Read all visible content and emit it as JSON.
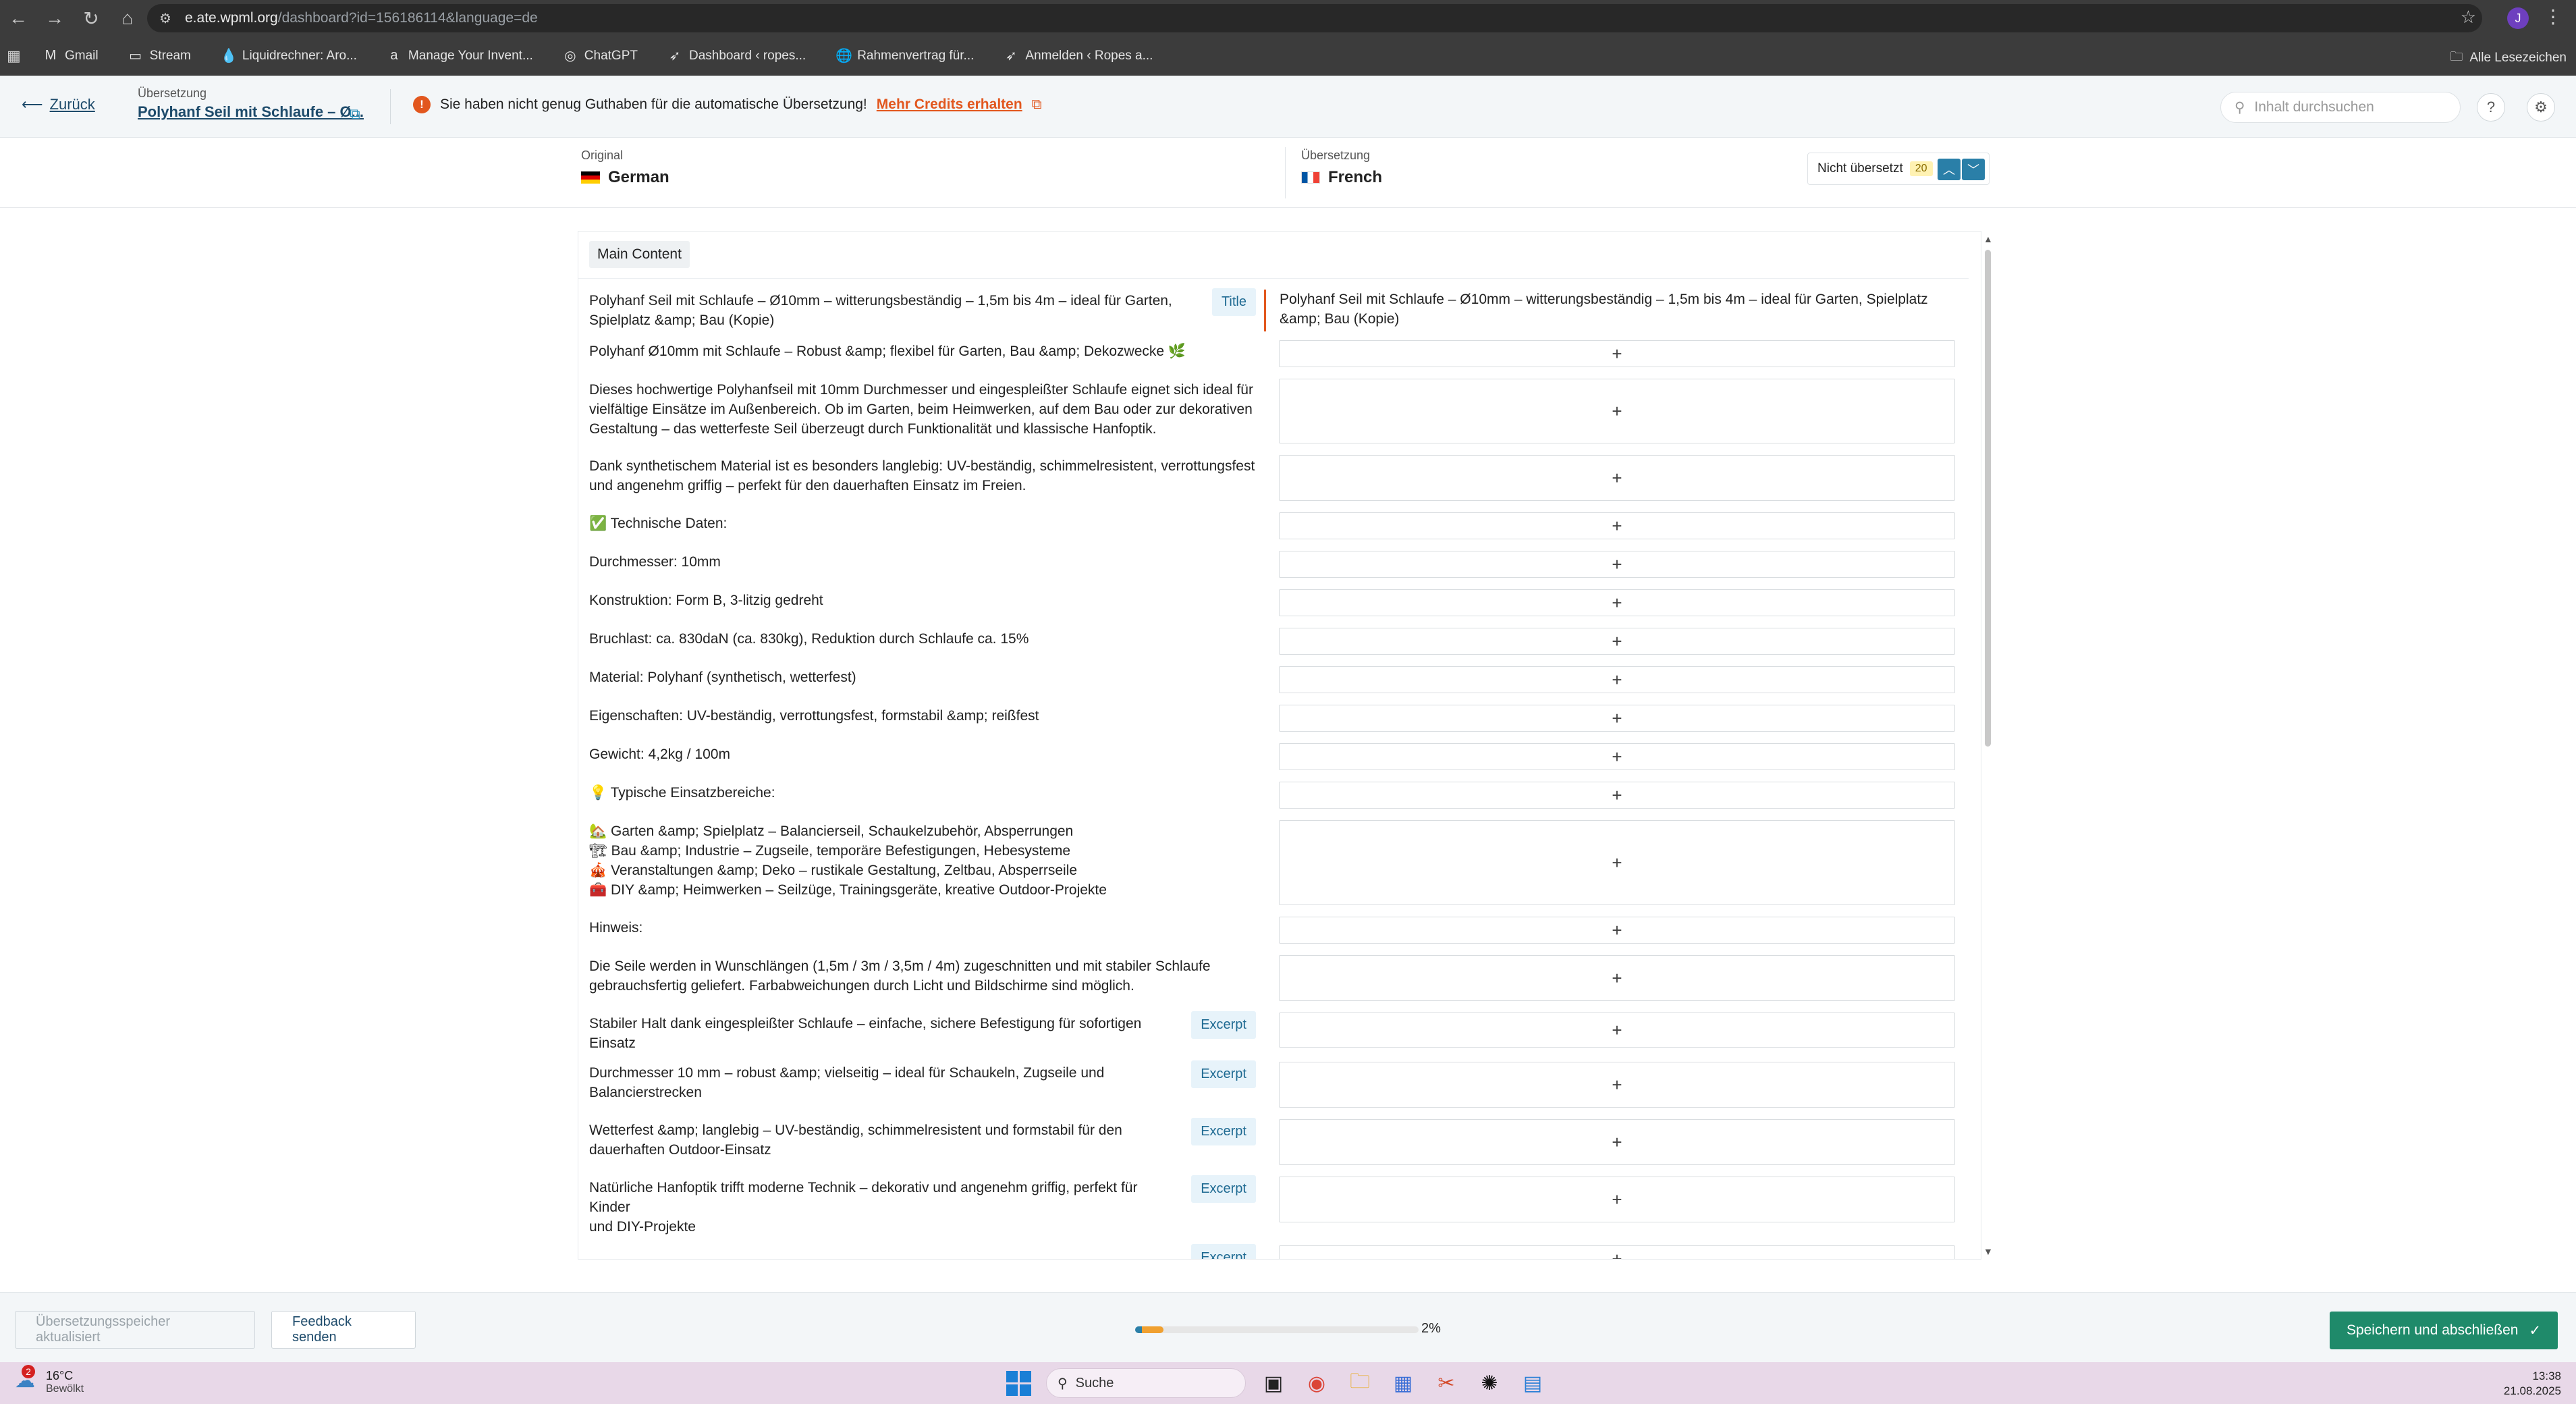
{
  "browser": {
    "url_host": "e.ate.wpml.org",
    "url_path": "/dashboard?id=156186114&language=de",
    "profile_initial": "J",
    "bookmarks": [
      {
        "icon": "gmail-icon",
        "glyph": "M",
        "label": "Gmail"
      },
      {
        "icon": "folder-icon",
        "glyph": "▭",
        "label": "Stream"
      },
      {
        "icon": "drop-icon",
        "glyph": "💧",
        "label": "Liquidrechner: Aro..."
      },
      {
        "icon": "amazon-icon",
        "glyph": "a",
        "label": "Manage Your Invent..."
      },
      {
        "icon": "chatgpt-icon",
        "glyph": "◎",
        "label": "ChatGPT"
      },
      {
        "icon": "ropes-icon",
        "glyph": "➶",
        "label": "Dashboard ‹ ropes..."
      },
      {
        "icon": "globe-icon",
        "glyph": "🌐",
        "label": "Rahmenvertrag für..."
      },
      {
        "icon": "ropes-icon",
        "glyph": "➶",
        "label": "Anmelden ‹ Ropes a..."
      }
    ],
    "all_bookmarks": "Alle Lesezeichen"
  },
  "header": {
    "back_label": "Zurück",
    "translation_label": "Übersetzung",
    "doc_title": "Polyhanf Seil mit Schlaufe – Ø...",
    "alert_text": "Sie haben nicht genug Guthaben für die automatische Übersetzung!",
    "alert_link": "Mehr Credits erhalten",
    "search_placeholder": "Inhalt durchsuchen"
  },
  "languages": {
    "original_label": "Original",
    "original_name": "German",
    "translation_label": "Übersetzung",
    "translation_name": "French",
    "filter_label": "Nicht übersetzt",
    "filter_count": "20"
  },
  "section_tag": "Main Content",
  "rows": [
    {
      "source": "Polyhanf Seil mit Schlaufe – Ø10mm – witterungsbeständig – 1,5m bis 4m – ideal für Garten,\nSpielplatz &amp; Bau (Kopie)",
      "tag": "Title",
      "target": "Polyhanf Seil mit Schlaufe – Ø10mm – witterungsbeständig – 1,5m bis 4m – ideal für Garten, Spielplatz\n&amp; Bau (Kopie)",
      "h": 62
    },
    {
      "source": "Polyhanf Ø10mm mit Schlaufe – Robust &amp; flexibel für Garten, Bau &amp; Dekozwecke 🌿",
      "tag": "",
      "target": "",
      "h": 44
    },
    {
      "source": "Dieses hochwertige Polyhanfseil mit 10mm Durchmesser und eingespleißter Schlaufe eignet sich ideal für\nvielfältige Einsätze im Außenbereich. Ob im Garten, beim Heimwerken, auf dem Bau oder zur dekorativen\nGestaltung – das wetterfeste Seil überzeugt durch Funktionalität und klassische Hanfoptik.",
      "tag": "",
      "target": "",
      "h": 100
    },
    {
      "source": "Dank synthetischem Material ist es besonders langlebig: UV-beständig, schimmelresistent, verrottungsfest\nund angenehm griffig – perfekt für den dauerhaften Einsatz im Freien.",
      "tag": "",
      "target": "",
      "h": 72
    },
    {
      "source": "✅ Technische Daten:",
      "tag": "",
      "target": "",
      "h": 44
    },
    {
      "source": "Durchmesser: 10mm",
      "tag": "",
      "target": "",
      "h": 44
    },
    {
      "source": "Konstruktion: Form B, 3-litzig gedreht",
      "tag": "",
      "target": "",
      "h": 44
    },
    {
      "source": "Bruchlast: ca. 830daN (ca. 830kg), Reduktion durch Schlaufe ca. 15%",
      "tag": "",
      "target": "",
      "h": 44
    },
    {
      "source": "Material: Polyhanf (synthetisch, wetterfest)",
      "tag": "",
      "target": "",
      "h": 44
    },
    {
      "source": "Eigenschaften: UV-beständig, verrottungsfest, formstabil &amp; reißfest",
      "tag": "",
      "target": "",
      "h": 44
    },
    {
      "source": "Gewicht: 4,2kg / 100m",
      "tag": "",
      "target": "",
      "h": 44
    },
    {
      "source": "💡 Typische Einsatzbereiche:",
      "tag": "",
      "target": "",
      "h": 44
    },
    {
      "source": "🏡 Garten &amp; Spielplatz – Balancierseil, Schaukelzubehör, Absperrungen\n🏗 Bau &amp; Industrie – Zugseile, temporäre Befestigungen, Hebesysteme\n🎪 Veranstaltungen &amp; Deko – rustikale Gestaltung, Zeltbau, Absperrseile\n🧰 DIY &amp; Heimwerken – Seilzüge, Trainingsgeräte, kreative Outdoor-Projekte",
      "tag": "",
      "target": "",
      "h": 130
    },
    {
      "source": "Hinweis:",
      "tag": "",
      "target": "",
      "h": 44
    },
    {
      "source": "Die Seile werden in Wunschlängen (1,5m / 3m / 3,5m / 4m) zugeschnitten und mit stabiler Schlaufe\ngebrauchsfertig geliefert. Farbabweichungen durch Licht und Bildschirme sind möglich.",
      "tag": "",
      "target": "",
      "h": 72
    },
    {
      "source": "Stabiler Halt dank eingespleißter Schlaufe – einfache, sichere Befestigung für sofortigen Einsatz",
      "tag": "Excerpt",
      "target": "",
      "h": 56
    },
    {
      "source": "Durchmesser 10 mm – robust &amp; vielseitig – ideal für Schaukeln, Zugseile und\nBalancierstrecken",
      "tag": "Excerpt",
      "target": "",
      "h": 72
    },
    {
      "source": "Wetterfest &amp; langlebig – UV-beständig, schimmelresistent und formstabil für den\ndauerhaften Outdoor-Einsatz",
      "tag": "Excerpt",
      "target": "",
      "h": 72
    },
    {
      "source": "Natürliche Hanfoptik trifft moderne Technik – dekorativ und angenehm griffig, perfekt für Kinder\nund DIY-Projekte",
      "tag": "Excerpt",
      "target": "",
      "h": 72
    },
    {
      "source": "",
      "tag": "Excerpt",
      "target": "",
      "h": 44
    }
  ],
  "footer": {
    "update_memory": "Übersetzungsspeicher aktualisiert",
    "feedback": "Feedback senden",
    "progress_percent": 2,
    "progress_label": "2%",
    "save": "Speichern und abschließen"
  },
  "taskbar": {
    "weather_badge": "2",
    "temperature": "16°C",
    "condition": "Bewölkt",
    "search": "Suche",
    "time": "13:38",
    "date": "21.08.2025"
  },
  "colors": {
    "accent": "#2a7fa8",
    "warning": "#e2571e",
    "save": "#1f8a6a"
  }
}
